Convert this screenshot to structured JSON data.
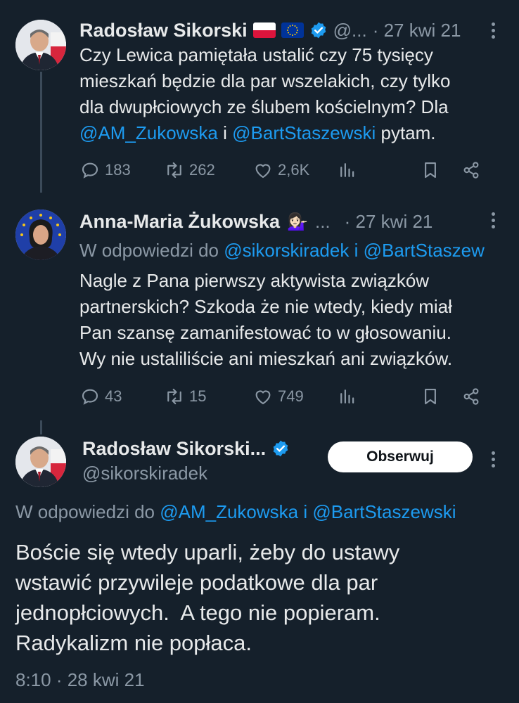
{
  "colors": {
    "background": "#15202b",
    "text": "#e7e9ea",
    "muted": "#8b98a5",
    "link": "#1d9bf0",
    "verified": "#1d9bf0"
  },
  "tweet1": {
    "name": "Radosław Sikorski",
    "handle": "@...",
    "date": "· 27 kwi 21",
    "flags": [
      "poland-flag-icon",
      "eu-flag-icon"
    ],
    "text_parts": {
      "p1": "Czy Lewica pamiętała ustalić czy 75 tysięcy",
      "p2": "mieszkań będzie dla par wszelakich, czy tylko",
      "p3": "dla dwupłciowych ze ślubem kościelnym? Dla",
      "mention1": "@AM_Zukowska",
      "conj": " i ",
      "mention2": "@BartStaszewski",
      "tail": " pytam."
    },
    "stats": {
      "replies": "183",
      "retweets": "262",
      "likes": "2,6K"
    }
  },
  "tweet2": {
    "name": "Anna-Maria Żukowska",
    "emoji": "💁🏻‍♀️",
    "ellipsis": "...",
    "date": "· 27 kwi 21",
    "reply_prefix": "W odpowiedzi do ",
    "reply_to1": "@sikorskiradek",
    "reply_conj": " i ",
    "reply_to2": "@BartStaszew",
    "lines": [
      "Nagle z Pana pierwszy aktywista związków",
      "partnerskich? Szkoda że nie wtedy, kiedy miał",
      "Pan szansę zamanifestować to w głosowaniu.",
      "Wy nie ustaliliście ani mieszkań ani związków."
    ],
    "stats": {
      "replies": "43",
      "retweets": "15",
      "likes": "749"
    }
  },
  "tweet3": {
    "name": "Radosław Sikorski...",
    "handle": "@sikorskiradek",
    "follow_label": "Obserwuj",
    "reply_prefix": "W odpowiedzi do ",
    "reply_to1": "@AM_Zukowska",
    "reply_conj": " i ",
    "reply_to2": "@BartStaszewski",
    "lines": [
      "Boście się wtedy uparli, żeby do ustawy",
      "wstawić przywileje podatkowe dla par",
      "jednopłciowych.  A tego nie popieram.",
      "Radykalizm nie popłaca."
    ],
    "timestamp": "8:10 · 28 kwi 21"
  }
}
